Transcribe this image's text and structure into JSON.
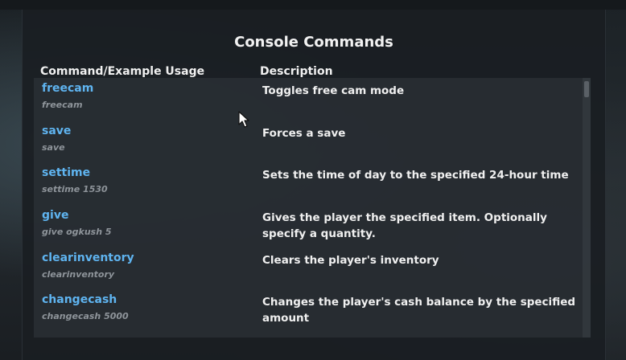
{
  "title": "Console Commands",
  "headers": {
    "command": "Command/Example Usage",
    "description": "Description"
  },
  "commands": [
    {
      "name": "freecam",
      "example": "freecam",
      "description": "Toggles free cam mode"
    },
    {
      "name": "save",
      "example": "save",
      "description": "Forces a save"
    },
    {
      "name": "settime",
      "example": "settime 1530",
      "description": "Sets the time of day to the specified 24-hour time"
    },
    {
      "name": "give",
      "example": "give ogkush 5",
      "description": "Gives the player the specified item. Optionally specify a quantity."
    },
    {
      "name": "clearinventory",
      "example": "clearinventory",
      "description": "Clears the player's inventory"
    },
    {
      "name": "changecash",
      "example": "changecash 5000",
      "description": "Changes the player's cash balance by the specified amount"
    }
  ],
  "colors": {
    "command": "#5fb4f0",
    "example": "#8e949a",
    "text": "#f0f0f0"
  }
}
